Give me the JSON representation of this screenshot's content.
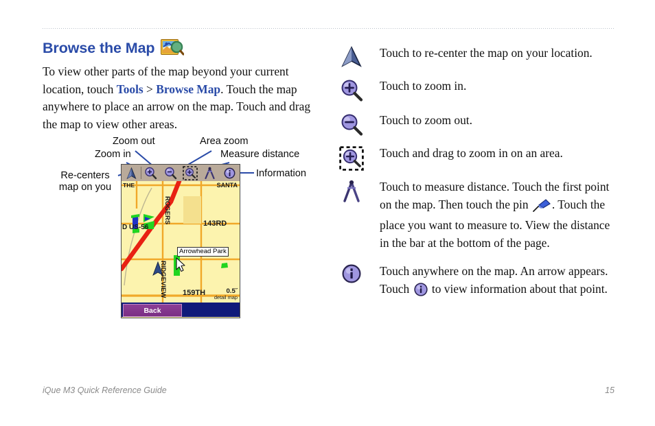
{
  "header": {
    "title": "Browse the Map",
    "title_icon": "browse-map-icon",
    "title_color": "#2a4ba8"
  },
  "intro": {
    "part1": "To view other parts of the map beyond your current location, touch ",
    "link1": "Tools",
    "sep": " > ",
    "link2": "Browse Map",
    "part2": ". Touch the map anywhere to place an arrow on the map. Touch and drag the map to view other areas."
  },
  "figure": {
    "callouts": {
      "zoom_out": "Zoom out",
      "zoom_in": "Zoom in",
      "area_zoom": "Area zoom",
      "measure_distance": "Measure distance",
      "re_centers": "Re-centers map on you",
      "information": "Information"
    },
    "device": {
      "toolbar_icons": [
        "recenter-arrow-icon",
        "zoom-in-icon",
        "zoom-out-icon",
        "area-zoom-icon",
        "measure-distance-icon",
        "information-icon"
      ],
      "map_labels": {
        "top_left": "THE",
        "top_right": "SANTA",
        "highway": "D US-56",
        "rogers": "ROGERS",
        "street_143rd": "143RD",
        "ridgeview": "RIDGEVIEW",
        "street_159th": "159TH",
        "poi": "Arrowhead Park"
      },
      "scale_value": "0.5˝",
      "scale_caption": "detail map",
      "back_button": "Back"
    }
  },
  "legend": [
    {
      "icon": "recenter-arrow-icon",
      "text": "Touch to re-center the map on your location."
    },
    {
      "icon": "zoom-in-icon",
      "text": "Touch to zoom in."
    },
    {
      "icon": "zoom-out-icon",
      "text": "Touch to zoom out."
    },
    {
      "icon": "area-zoom-icon",
      "text": "Touch and drag to zoom in on an area."
    },
    {
      "icon": "measure-distance-icon",
      "text_a": "Touch to measure distance. Touch the first point on the map. Then touch the pin ",
      "inline_icon": "pushpin-icon",
      "text_b": ". Touch the place you want to measure to. View the distance in the bar at the bottom of the page."
    },
    {
      "icon": "information-icon",
      "text_a": "Touch anywhere on the map. An arrow appears. Touch ",
      "inline_icon": "information-icon",
      "text_b": " to view information about that point."
    }
  ],
  "footer": {
    "guide_name": "iQue M3 Quick Reference Guide",
    "page_number": "15"
  },
  "colors": {
    "accent_blue": "#2a4ba8",
    "icon_purple": "#8f86d6",
    "map_yellow": "#fcf3ae",
    "road_red": "#e82113",
    "road_orange": "#f0a829",
    "park_green": "#21d521",
    "device_bottom_blue": "#101a7a",
    "back_purple": "#8d3f96",
    "footer_gray": "#8a8a8a"
  }
}
